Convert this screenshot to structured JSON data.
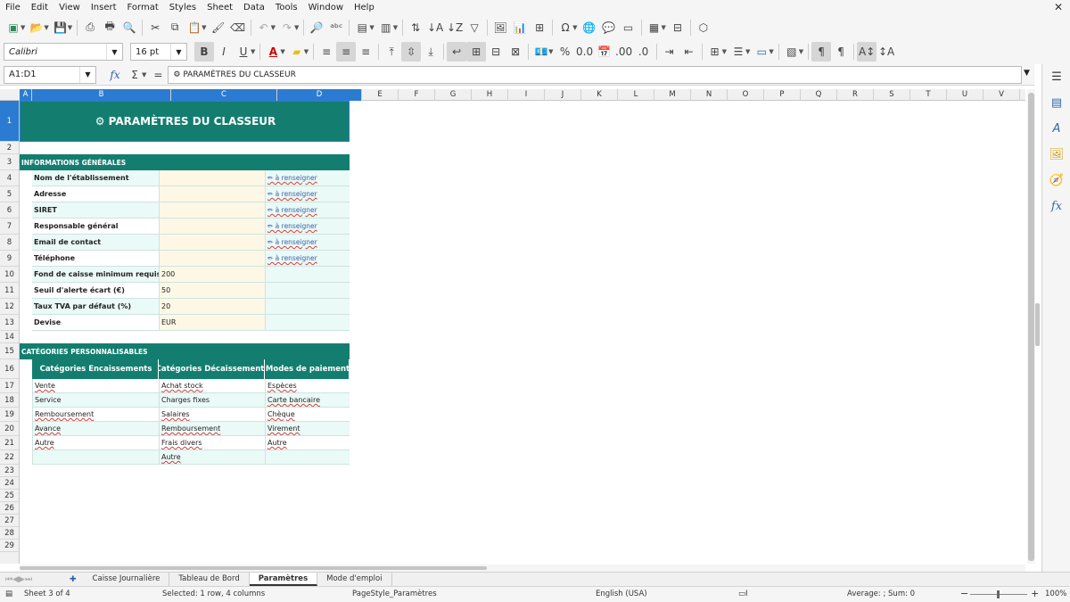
{
  "menu": [
    "File",
    "Edit",
    "View",
    "Insert",
    "Format",
    "Styles",
    "Sheet",
    "Data",
    "Tools",
    "Window",
    "Help"
  ],
  "font": {
    "name": "Calibri",
    "size": "16 pt"
  },
  "name_box": "A1:D1",
  "formula": "⚙ PARAMÈTRES DU CLASSEUR",
  "columns": [
    "A",
    "B",
    "C",
    "D",
    "E",
    "F",
    "G",
    "H",
    "I",
    "J",
    "K",
    "L",
    "M",
    "N",
    "O",
    "P",
    "Q",
    "R",
    "S",
    "T",
    "U",
    "V"
  ],
  "rows": [
    "1",
    "2",
    "3",
    "4",
    "5",
    "6",
    "7",
    "8",
    "9",
    "10",
    "11",
    "12",
    "13",
    "14",
    "15",
    "16",
    "17",
    "18",
    "19",
    "20",
    "21",
    "22",
    "23",
    "24",
    "25",
    "26",
    "27",
    "28",
    "29"
  ],
  "sheet": {
    "title": "⚙ PARAMÈTRES DU CLASSEUR",
    "section1": "INFORMATIONS GÉNÉRALES",
    "info_rows": [
      {
        "label": "Nom de l'établissement",
        "value": "",
        "hint": "✏ à renseigner"
      },
      {
        "label": "Adresse",
        "value": "",
        "hint": "✏ à renseigner"
      },
      {
        "label": "SIRET",
        "value": "",
        "hint": "✏ à renseigner"
      },
      {
        "label": "Responsable général",
        "value": "",
        "hint": "✏ à renseigner"
      },
      {
        "label": "Email de contact",
        "value": "",
        "hint": "✏ à renseigner"
      },
      {
        "label": "Téléphone",
        "value": "",
        "hint": "✏ à renseigner"
      },
      {
        "label": "Fond de caisse minimum requis (€)",
        "value": "200",
        "hint": ""
      },
      {
        "label": "Seuil d'alerte écart (€)",
        "value": "50",
        "hint": ""
      },
      {
        "label": "Taux TVA par défaut (%)",
        "value": "20",
        "hint": ""
      },
      {
        "label": "Devise",
        "value": "EUR",
        "hint": ""
      }
    ],
    "section2": "CATÉGORIES PERSONNALISABLES",
    "cat_headers": [
      "Catégories Encaissements",
      "Catégories Décaissements",
      "Modes de paiement"
    ],
    "cat_rows": [
      [
        "Vente",
        "Achat stock",
        "Espèces"
      ],
      [
        "Service",
        "Charges fixes",
        "Carte bancaire"
      ],
      [
        "Remboursement",
        "Salaires",
        "Chèque"
      ],
      [
        "Avance",
        "Remboursement",
        "Virement"
      ],
      [
        "Autre",
        "Frais divers",
        "Autre"
      ],
      [
        "",
        "Autre",
        ""
      ]
    ]
  },
  "tabs": [
    "Caisse Journalière",
    "Tableau de Bord",
    "Paramètres",
    "Mode d'emploi"
  ],
  "active_tab": 2,
  "status": {
    "sheet": "Sheet 3 of 4",
    "selection": "Selected: 1 row, 4 columns",
    "pagestyle": "PageStyle_Paramètres",
    "lang": "English (USA)",
    "summary": "Average: ; Sum: 0",
    "zoom": "100%"
  },
  "colors": {
    "accent": "#137e6f",
    "select": "#2b7bd2",
    "input": "#fdf8e6",
    "alt": "#eafaf6"
  }
}
